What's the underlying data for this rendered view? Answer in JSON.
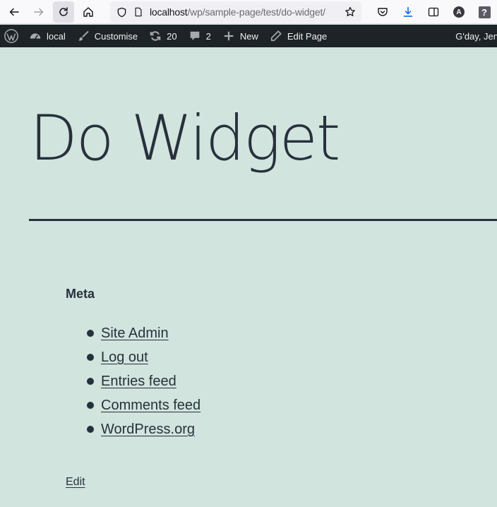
{
  "browser": {
    "url_host": "localhost",
    "url_path": "/wp/sample-page/test/do-widget/",
    "profile_initial": "A",
    "help_glyph": "?"
  },
  "adminbar": {
    "items": [
      {
        "label": "local",
        "icon": "dashboard-icon"
      },
      {
        "label": "Customise",
        "icon": "paintbrush-icon"
      },
      {
        "label": "20",
        "icon": "updates-icon"
      },
      {
        "label": "2",
        "icon": "comment-icon"
      },
      {
        "label": "New",
        "icon": "plus-icon"
      },
      {
        "label": "Edit Page",
        "icon": "pencil-icon"
      }
    ],
    "greeting": "G'day, Jen"
  },
  "page": {
    "title": "Do Widget",
    "widget": {
      "title": "Meta",
      "links": [
        "Site Admin",
        "Log out",
        "Entries feed",
        "Comments feed",
        "WordPress.org"
      ]
    },
    "edit_label": "Edit"
  }
}
